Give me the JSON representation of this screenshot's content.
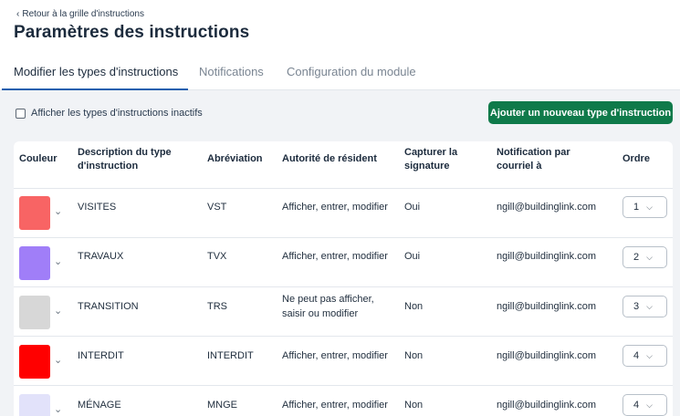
{
  "header": {
    "back_label": "Retour à la grille d'instructions",
    "title": "Paramètres des instructions"
  },
  "tabs": [
    {
      "label": "Modifier les types d'instructions",
      "active": true
    },
    {
      "label": "Notifications",
      "active": false
    },
    {
      "label": "Configuration du module",
      "active": false
    }
  ],
  "toolbar": {
    "show_inactive_label": "Afficher les types d'instructions inactifs",
    "show_inactive_checked": false,
    "add_button_label": "Ajouter un nouveau type d'instruction"
  },
  "table": {
    "columns": {
      "color": "Couleur",
      "description_1": "Description du type",
      "description_2": "d'instruction",
      "abbreviation": "Abréviation",
      "authority": "Autorité de résident",
      "signature_1": "Capturer la",
      "signature_2": "signature",
      "email_1": "Notification par",
      "email_2": "courriel à",
      "order": "Ordre"
    },
    "rows": [
      {
        "color": "#f86464",
        "description": "VISITES",
        "abbreviation": "VST",
        "authority_1": "Afficher, entrer, modifier",
        "authority_2": "",
        "signature": "Oui",
        "email": "ngill@buildinglink.com",
        "order": "1"
      },
      {
        "color": "#a07ef8",
        "description": "TRAVAUX",
        "abbreviation": "TVX",
        "authority_1": "Afficher, entrer, modifier",
        "authority_2": "",
        "signature": "Oui",
        "email": "ngill@buildinglink.com",
        "order": "2"
      },
      {
        "color": "#d7d7d7",
        "description": "TRANSITION",
        "abbreviation": "TRS",
        "authority_1": "Ne peut pas afficher,",
        "authority_2": "saisir ou modifier",
        "signature": "Non",
        "email": "ngill@buildinglink.com",
        "order": "3"
      },
      {
        "color": "#ff0000",
        "description": "INTERDIT",
        "abbreviation": "INTERDIT",
        "authority_1": "Afficher, entrer, modifier",
        "authority_2": "",
        "signature": "Non",
        "email": "ngill@buildinglink.com",
        "order": "4"
      },
      {
        "color": "#e2e2fa",
        "description": "MÉNAGE",
        "abbreviation": "MNGE",
        "authority_1": "Afficher, entrer, modifier",
        "authority_2": "",
        "signature": "Non",
        "email": "ngill@buildinglink.com",
        "order": "4"
      }
    ]
  },
  "icons": {
    "back": "chevron-left-icon",
    "dropdown": "chevron-down-icon"
  }
}
